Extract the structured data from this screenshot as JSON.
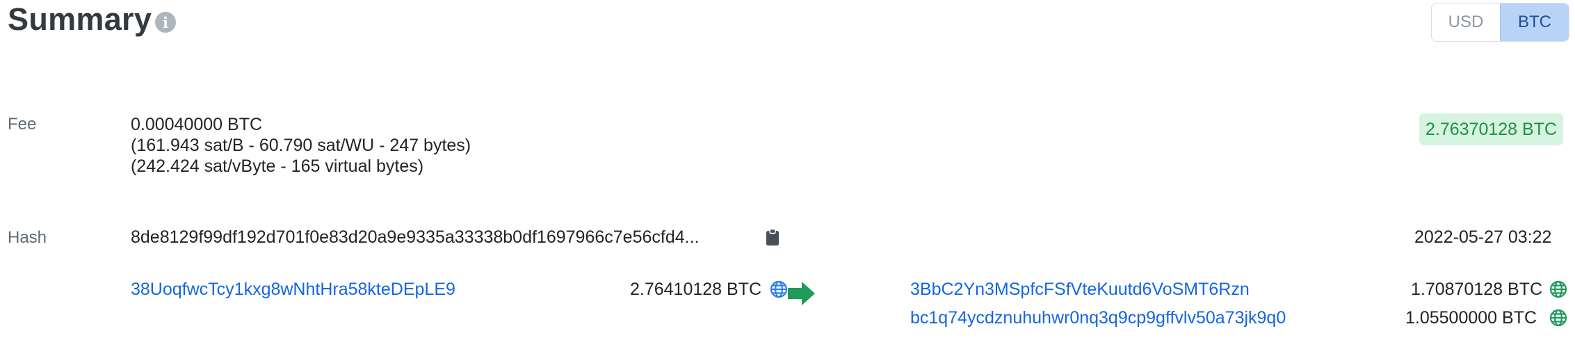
{
  "header": {
    "title": "Summary",
    "info_glyph": "i",
    "currency_toggle": {
      "options": [
        "USD",
        "BTC"
      ],
      "selected": "BTC"
    }
  },
  "fee": {
    "label": "Fee",
    "amount": "0.00040000 BTC",
    "detail1": "(161.943 sat/B - 60.790 sat/WU - 247 bytes)",
    "detail2": "(242.424 sat/vByte - 165 virtual bytes)",
    "total": "2.76370128 BTC"
  },
  "hash": {
    "label": "Hash",
    "value": "8de8129f99df192d701f0e83d20a9e9335a33338b0df1697966c7e56cfd4...",
    "timestamp": "2022-05-27 03:22"
  },
  "inputs": [
    {
      "address": "38UoqfwcTcy1kxg8wNhtHra58kteDEpLE9",
      "amount": "2.76410128 BTC"
    }
  ],
  "outputs": [
    {
      "address": "3BbC2Yn3MSpfcFSfVteKuutd6VoSMT6Rzn",
      "amount": "1.70870128 BTC"
    },
    {
      "address": "bc1q74ycdznuhuhwr0nq3q9cp9gffvlv50a73jk9q0",
      "amount": "1.05500000 BTC"
    }
  ],
  "colors": {
    "link": "#1565e6",
    "total_badge_bg": "#d6f3df",
    "total_badge_text": "#1e8f46",
    "arrow": "#1e9a5a",
    "input_globe": "#2f7ee6",
    "output_globe": "#1e9a5a"
  },
  "icons": [
    "info-icon",
    "clipboard-icon",
    "globe-icon",
    "arrow-right-icon"
  ]
}
